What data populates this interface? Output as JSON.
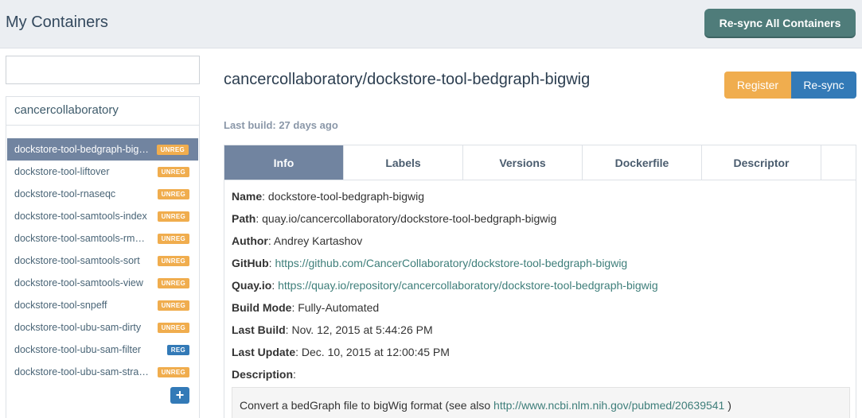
{
  "header": {
    "title": "My Containers",
    "resync_all_label": "Re-sync All Containers"
  },
  "sidebar": {
    "search_value": "",
    "namespace": "cancercollaboratory",
    "items": [
      {
        "label": "dockstore-tool-bedgraph-bigwig",
        "badge": "UNREG"
      },
      {
        "label": "dockstore-tool-liftover",
        "badge": "UNREG"
      },
      {
        "label": "dockstore-tool-rnaseqc",
        "badge": "UNREG"
      },
      {
        "label": "dockstore-tool-samtools-index",
        "badge": "UNREG"
      },
      {
        "label": "dockstore-tool-samtools-rmdup",
        "badge": "UNREG"
      },
      {
        "label": "dockstore-tool-samtools-sort",
        "badge": "UNREG"
      },
      {
        "label": "dockstore-tool-samtools-view",
        "badge": "UNREG"
      },
      {
        "label": "dockstore-tool-snpeff",
        "badge": "UNREG"
      },
      {
        "label": "dockstore-tool-ubu-sam-dirty",
        "badge": "UNREG"
      },
      {
        "label": "dockstore-tool-ubu-sam-filter",
        "badge": "REG"
      },
      {
        "label": "dockstore-tool-ubu-sam-strand",
        "badge": "UNREG"
      }
    ],
    "add_icon": "plus-icon",
    "active_color": "#7184a0",
    "unreg_color": "#f0ad4e",
    "reg_color": "#337ab7"
  },
  "main": {
    "title": "cancercollaboratory/dockstore-tool-bedgraph-bigwig",
    "last_build": "Last build: 27 days ago",
    "register_label": "Register",
    "resync_label": "Re-sync",
    "tabs": [
      "Info",
      "Labels",
      "Versions",
      "Dockerfile",
      "Descriptor"
    ],
    "info": {
      "name_label": "Name",
      "name": "dockstore-tool-bedgraph-bigwig",
      "path_label": "Path",
      "path": "quay.io/cancercollaboratory/dockstore-tool-bedgraph-bigwig",
      "author_label": "Author",
      "author": "Andrey Kartashov",
      "github_label": "GitHub",
      "github": "https://github.com/CancerCollaboratory/dockstore-tool-bedgraph-bigwig",
      "quay_label": "Quay.io",
      "quay": "https://quay.io/repository/cancercollaboratory/dockstore-tool-bedgraph-bigwig",
      "build_mode_label": "Build Mode",
      "build_mode": "Fully-Automated",
      "last_build_label": "Last Build",
      "last_build": "Nov. 12, 2015 at 5:44:26 PM",
      "last_update_label": "Last Update",
      "last_update": "Dec. 10, 2015 at 12:00:45 PM",
      "description_label": "Description",
      "description_text": "Convert a bedGraph file to bigWig format (see also",
      "description_link": "http://www.ncbi.nlm.nih.gov/pubmed/20639541",
      "description_suffix": ")"
    }
  }
}
